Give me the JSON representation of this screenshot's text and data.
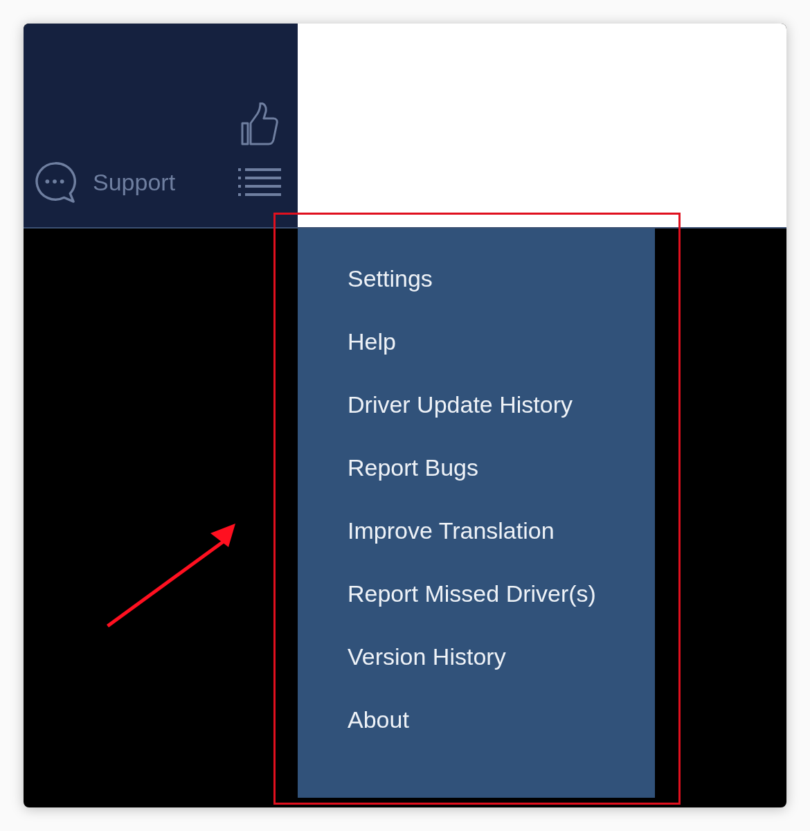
{
  "sidebar": {
    "support_label": "Support"
  },
  "menu": {
    "items": [
      {
        "label": "Settings"
      },
      {
        "label": "Help"
      },
      {
        "label": "Driver Update History"
      },
      {
        "label": "Report Bugs"
      },
      {
        "label": "Improve Translation"
      },
      {
        "label": "Report Missed Driver(s)"
      },
      {
        "label": "Version History"
      },
      {
        "label": "About"
      }
    ]
  }
}
